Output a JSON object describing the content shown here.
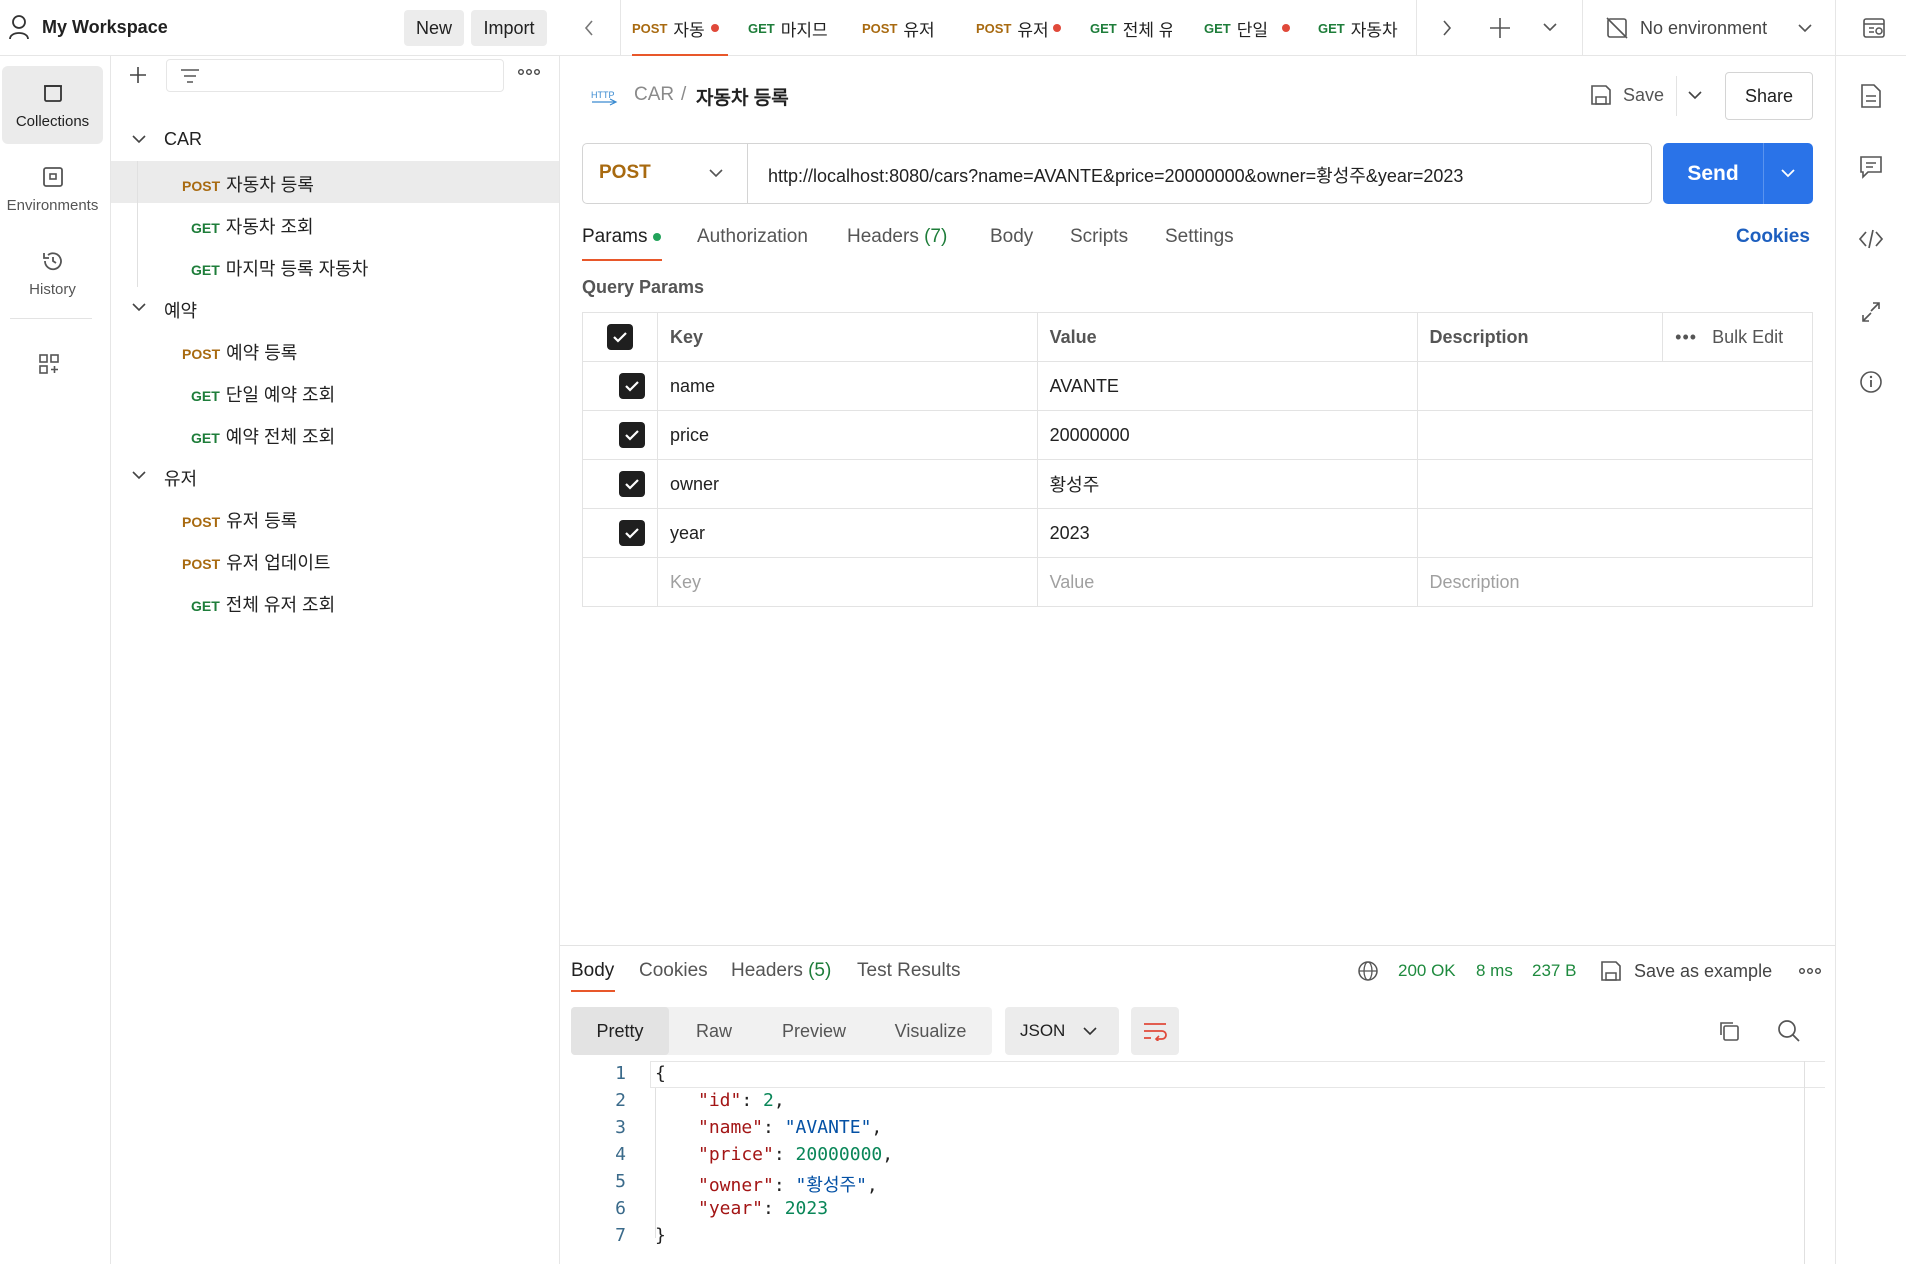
{
  "workspace": {
    "title": "My Workspace",
    "new_label": "New",
    "import_label": "Import"
  },
  "rail": [
    {
      "label": "Collections",
      "icon": "collections-icon"
    },
    {
      "label": "Environments",
      "icon": "environments-icon"
    },
    {
      "label": "History",
      "icon": "history-icon"
    }
  ],
  "tree": {
    "items": [
      {
        "type": "folder",
        "label": "CAR"
      },
      {
        "method": "POST",
        "label": "자동차 등록",
        "selected": true
      },
      {
        "method": "GET",
        "label": "자동차 조회"
      },
      {
        "method": "GET",
        "label": "마지막 등록 자동차"
      },
      {
        "type": "folder",
        "label": "예약"
      },
      {
        "method": "POST",
        "label": "예약 등록"
      },
      {
        "method": "GET",
        "label": "단일 예약 조회"
      },
      {
        "method": "GET",
        "label": "예약 전체 조회"
      },
      {
        "type": "folder",
        "label": "유저"
      },
      {
        "method": "POST",
        "label": "유저 등록"
      },
      {
        "method": "POST",
        "label": "유저 업데이트"
      },
      {
        "method": "GET",
        "label": "전체 유저 조회"
      }
    ]
  },
  "tabs": [
    {
      "method": "POST",
      "label": "자동",
      "dot": true,
      "active": true
    },
    {
      "method": "GET",
      "label": "마지므"
    },
    {
      "method": "POST",
      "label": "유저"
    },
    {
      "method": "POST",
      "label": "유저",
      "dot": true
    },
    {
      "method": "GET",
      "label": "전체 유"
    },
    {
      "method": "GET",
      "label": "단일",
      "dot": true
    },
    {
      "method": "GET",
      "label": "자동차"
    }
  ],
  "environment": {
    "label": "No environment"
  },
  "request": {
    "breadcrumb_parent": "CAR",
    "breadcrumb_sep": "/",
    "title": "자동차 등록",
    "save_label": "Save",
    "share_label": "Share",
    "method": "POST",
    "url": "http://localhost:8080/cars?name=AVANTE&price=20000000&owner=황성주&year=2023",
    "send_label": "Send"
  },
  "request_tabs": {
    "params": "Params",
    "authorization": "Authorization",
    "headers": "Headers",
    "headers_count": "(7)",
    "body": "Body",
    "scripts": "Scripts",
    "settings": "Settings",
    "cookies": "Cookies"
  },
  "query_params": {
    "title": "Query Params",
    "headers": {
      "key": "Key",
      "value": "Value",
      "description": "Description",
      "bulk_edit": "Bulk Edit"
    },
    "rows": [
      {
        "key": "name",
        "value": "AVANTE",
        "description": ""
      },
      {
        "key": "price",
        "value": "20000000",
        "description": ""
      },
      {
        "key": "owner",
        "value": "황성주",
        "description": ""
      },
      {
        "key": "year",
        "value": "2023",
        "description": ""
      }
    ],
    "placeholders": {
      "key": "Key",
      "value": "Value",
      "description": "Description"
    }
  },
  "response": {
    "tabs": {
      "body": "Body",
      "cookies": "Cookies",
      "headers": "Headers",
      "headers_count": "(5)",
      "test_results": "Test Results"
    },
    "status": "200 OK",
    "time": "8 ms",
    "size": "237 B",
    "save_example": "Save as example",
    "views": {
      "pretty": "Pretty",
      "raw": "Raw",
      "preview": "Preview",
      "visualize": "Visualize"
    },
    "format": "JSON",
    "lines": [
      "1",
      "2",
      "3",
      "4",
      "5",
      "6",
      "7"
    ],
    "body": {
      "open": "{",
      "close": "}",
      "fields": [
        {
          "key": "\"id\"",
          "value": "2",
          "kind": "n",
          "comma": ","
        },
        {
          "key": "\"name\"",
          "value": "\"AVANTE\"",
          "kind": "s",
          "comma": ","
        },
        {
          "key": "\"price\"",
          "value": "20000000",
          "kind": "n",
          "comma": ","
        },
        {
          "key": "\"owner\"",
          "value": "\"황성주\"",
          "kind": "s",
          "comma": ","
        },
        {
          "key": "\"year\"",
          "value": "2023",
          "kind": "n",
          "comma": ""
        }
      ]
    }
  },
  "colors": {
    "accent": "#2a73e8",
    "post": "#a86a10",
    "get": "#1e7d3a",
    "status_ok": "#1e8a3e",
    "tab_underline": "#e8572a"
  }
}
